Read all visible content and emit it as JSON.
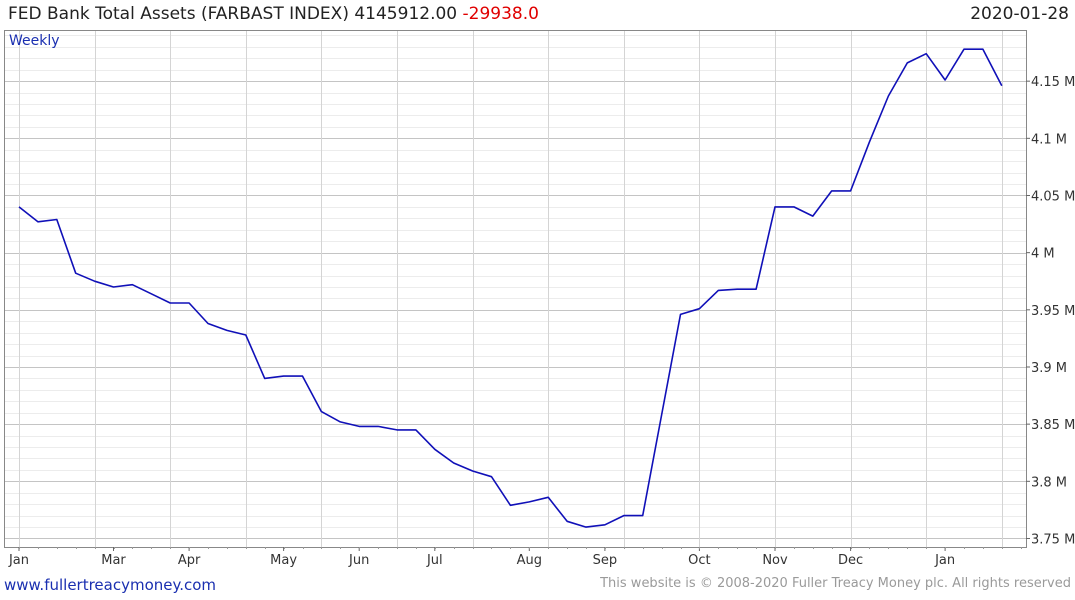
{
  "header": {
    "title": "FED Bank Total Assets (FARBAST INDEX) 4145912.00",
    "change": "-29938.0",
    "date": "2020-01-28"
  },
  "footer": {
    "left": "www.fullertreacymoney.com",
    "right": "This website is © 2008-2020 Fuller Treacy Money plc. All rights reserved"
  },
  "colors": {
    "line": "#1010b8",
    "change": "#e00000",
    "grid": "#d4d4d4",
    "footer_link": "#1a2fb0"
  },
  "chart_data": {
    "type": "line",
    "title": "FED Bank Total Assets (FARBAST INDEX)",
    "frequency_label": "Weekly",
    "y_axis_position": "right",
    "ylim": [
      3750000,
      4190000
    ],
    "y_ticks": [
      {
        "value": 3750000,
        "label": "3.75 M"
      },
      {
        "value": 3800000,
        "label": "3.8 M"
      },
      {
        "value": 3850000,
        "label": "3.85 M"
      },
      {
        "value": 3900000,
        "label": "3.9 M"
      },
      {
        "value": 3950000,
        "label": "3.95 M"
      },
      {
        "value": 4000000,
        "label": "4 M"
      },
      {
        "value": 4050000,
        "label": "4.05 M"
      },
      {
        "value": 4100000,
        "label": "4.1 M"
      },
      {
        "value": 4150000,
        "label": "4.15 M"
      }
    ],
    "x_ticks": [
      {
        "week": 0,
        "label": "Jan"
      },
      {
        "week": 5,
        "label": "Mar"
      },
      {
        "week": 9,
        "label": "Apr"
      },
      {
        "week": 14,
        "label": "May"
      },
      {
        "week": 18,
        "label": "Jun"
      },
      {
        "week": 22,
        "label": "Jul"
      },
      {
        "week": 27,
        "label": "Aug"
      },
      {
        "week": 31,
        "label": "Sep"
      },
      {
        "week": 36,
        "label": "Oct"
      },
      {
        "week": 40,
        "label": "Nov"
      },
      {
        "week": 44,
        "label": "Dec"
      },
      {
        "week": 49,
        "label": "Jan"
      }
    ],
    "grid": true,
    "series": [
      {
        "values": [
          4040000,
          4027000,
          4029000,
          3982000,
          3975000,
          3970000,
          3972000,
          3964000,
          3956000,
          3956000,
          3938000,
          3932000,
          3928000,
          3890000,
          3892000,
          3892000,
          3861000,
          3852000,
          3848000,
          3848000,
          3845000,
          3845000,
          3828000,
          3816000,
          3809000,
          3804000,
          3779000,
          3782000,
          3786000,
          3765000,
          3760000,
          3762000,
          3770000,
          3770000,
          3858000,
          3946000,
          3951000,
          3967000,
          3968000,
          3968000,
          4040000,
          4040000,
          4032000,
          4054000,
          4054000,
          4097000,
          4137000,
          4166000,
          4174000,
          4151000,
          4178000,
          4178000,
          4146000
        ]
      }
    ]
  }
}
